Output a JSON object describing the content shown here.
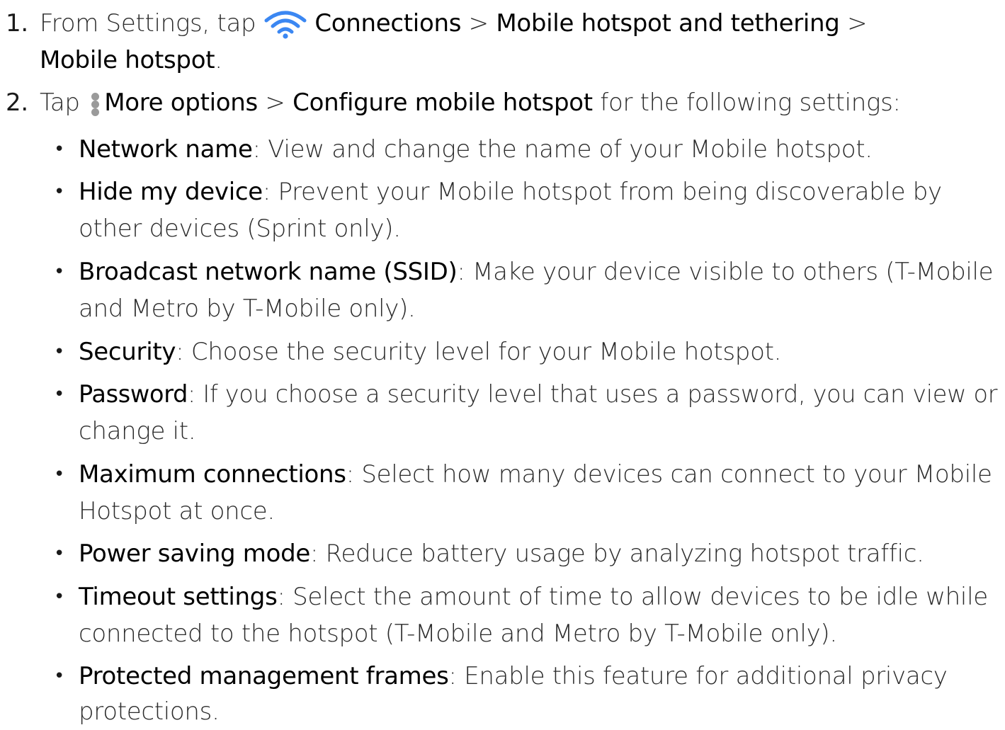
{
  "step1": {
    "number": "1.",
    "prefix": "From Settings, tap",
    "icon": "wifi-icon",
    "icon_color": "#3b87f2",
    "connections": "Connections",
    "sep1": " > ",
    "mobile_hotspot_tethering": "Mobile hotspot and tethering",
    "sep2": " >",
    "mobile_hotspot": "Mobile hotspot",
    "end": "."
  },
  "step2": {
    "number": "2.",
    "prefix": "Tap",
    "icon": "more-options-icon",
    "icon_color": "#9a9a9a",
    "more_options": "More options",
    "sep": " > ",
    "configure": "Configure mobile hotspot",
    "suffix": " for the following settings:"
  },
  "settings": [
    {
      "term": "Network name",
      "desc_lines": [
        ": View and change the name of your Mobile hotspot."
      ]
    },
    {
      "term": "Hide my device",
      "desc_lines": [
        ": Prevent your Mobile hotspot from being discoverable by",
        "other devices (Sprint only)."
      ]
    },
    {
      "term": "Broadcast network name (SSID)",
      "desc_lines": [
        ": Make your device visible to others (T-Mobile",
        "and Metro by T-Mobile only)."
      ]
    },
    {
      "term": "Security",
      "desc_lines": [
        ": Choose the security level for your Mobile hotspot."
      ]
    },
    {
      "term": "Password",
      "desc_lines": [
        ": If you choose a security level that uses a password, you can view or",
        "change it."
      ]
    },
    {
      "term": "Maximum connections",
      "desc_lines": [
        ": Select how many devices can connect to your Mobile",
        "Hotspot at once."
      ]
    },
    {
      "term": "Power saving mode",
      "desc_lines": [
        ": Reduce battery usage by analyzing hotspot traffic."
      ]
    },
    {
      "term": "Timeout settings",
      "desc_lines": [
        ": Select the amount of time to allow devices to be idle while",
        "connected to the hotspot (T-Mobile and Metro by T-Mobile only)."
      ]
    },
    {
      "term": "Protected management frames",
      "desc_lines": [
        ": Enable this feature for additional privacy",
        "protections."
      ]
    }
  ],
  "bullet_char": "•"
}
